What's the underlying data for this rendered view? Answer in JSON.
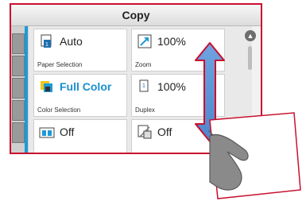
{
  "screen": {
    "title": "Copy"
  },
  "tiles": [
    {
      "value": "Auto",
      "caption": "Paper Selection",
      "icon": "paper-tray-icon"
    },
    {
      "value": "100%",
      "caption": "Zoom",
      "icon": "zoom-arrow-icon"
    },
    {
      "value": "Full Color",
      "caption": "Color Selection",
      "icon": "color-icon"
    },
    {
      "value": "100%",
      "caption": "Duplex",
      "icon": "duplex-icon"
    },
    {
      "value": "Off",
      "caption": "",
      "icon": "combine-icon"
    },
    {
      "value": "Off",
      "caption": "",
      "icon": "density-icon"
    }
  ],
  "scroll": {
    "up_icon": "chevron-up-icon"
  },
  "colors": {
    "frame": "#c8102e",
    "accent_blue": "#1e9ad6",
    "arrow_blue": "#5b8fd0",
    "arrow_red": "#c8102e"
  }
}
